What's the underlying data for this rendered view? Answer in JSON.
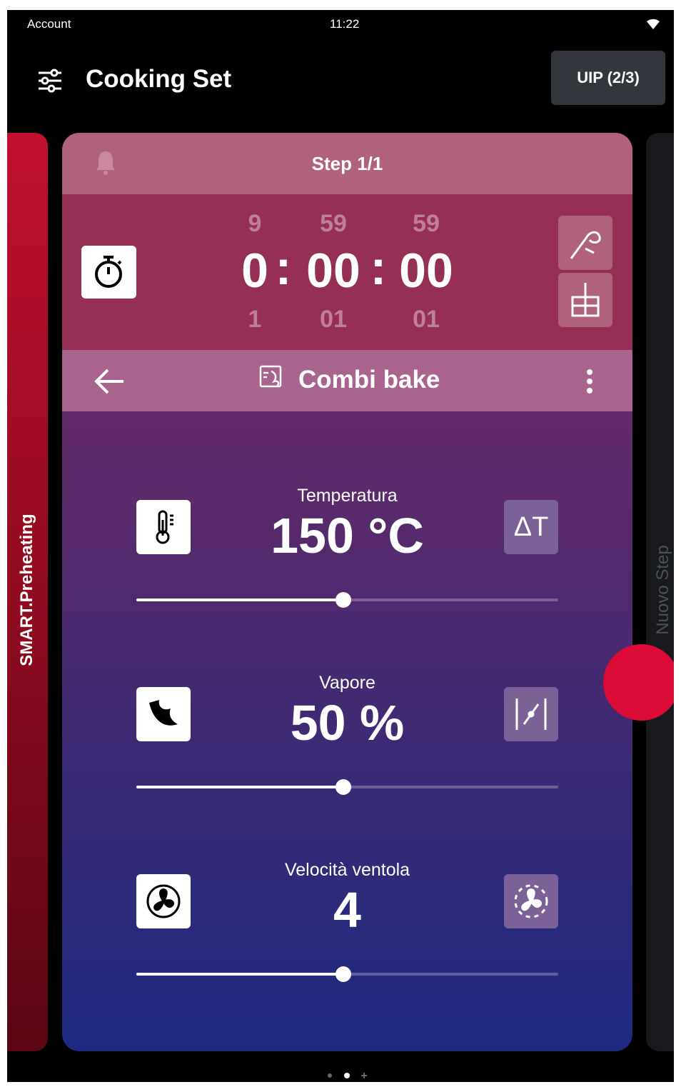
{
  "status": {
    "account": "Account",
    "time": "11:22",
    "wifi_icon": "wifi-icon"
  },
  "header": {
    "title": "Cooking Set",
    "uip_label": "UIP (2/3)",
    "menu_icon": "sliders-icon"
  },
  "left_panel": {
    "label": "SMART.Preheating"
  },
  "right_panel": {
    "label": "Nuovo Step"
  },
  "step": {
    "label": "Step 1/1",
    "icon": "bell-icon"
  },
  "timer": {
    "above": [
      "9",
      "59",
      "59"
    ],
    "current": [
      "0",
      "00",
      "00"
    ],
    "below": [
      "1",
      "01",
      "01"
    ],
    "separator": ":",
    "icon": "stopwatch-icon",
    "side_icons": [
      "core-probe-icon",
      "tray-icon"
    ]
  },
  "mode": {
    "name": "Combi bake",
    "icon": "combi-bake-icon"
  },
  "params": [
    {
      "label": "Temperatura",
      "value": "150 °C",
      "left_icon": "thermometer-icon",
      "right_label": "ΔT",
      "level": 0.49
    },
    {
      "label": "Vapore",
      "value": "50 %",
      "left_icon": "steam-icon",
      "right_icon": "humidity-icon",
      "level": 0.49
    },
    {
      "label": "Velocità ventola",
      "value": "4",
      "left_icon": "fan-icon",
      "right_icon": "fan-pulse-icon",
      "level": 0.49
    }
  ],
  "colors": {
    "accent_red": "#dc0a36",
    "card_top": "#7a2b5e",
    "card_bottom": "#1e2a82"
  },
  "pager": {
    "count": 2,
    "active": 1
  }
}
